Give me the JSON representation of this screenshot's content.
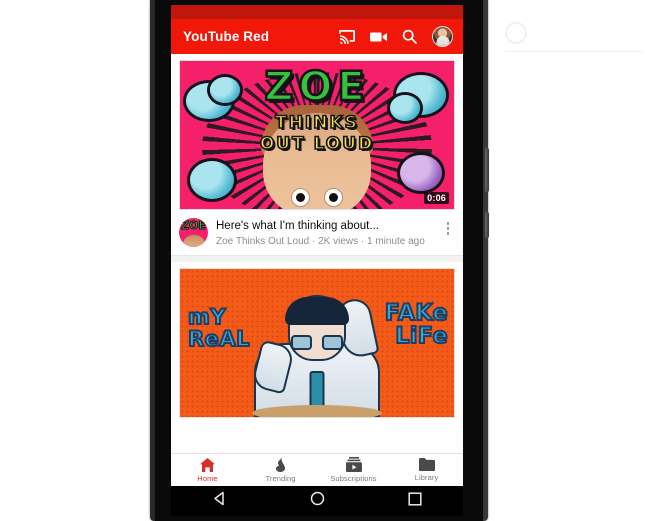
{
  "watermark": {
    "text": ""
  },
  "phone": {
    "status_bar_color": "#c0160b",
    "app_bar_color": "#f11709"
  },
  "appbar": {
    "title": "YouTube Red",
    "actions": [
      {
        "name": "cast-icon",
        "label": "Cast"
      },
      {
        "name": "camcorder-icon",
        "label": "Upload video"
      },
      {
        "name": "search-icon",
        "label": "Search"
      },
      {
        "name": "avatar",
        "label": "Account"
      }
    ]
  },
  "feed": {
    "videos": [
      {
        "title": "Here's what I'm thinking about...",
        "channel": "Zoe Thinks Out Loud",
        "views": "2K views",
        "age": "1 minute ago",
        "meta": "Zoe Thinks Out Loud · 2K views · 1 minute ago",
        "duration": "0:06",
        "thumbnail": {
          "name": "zoe-thinks-out-loud-thumbnail",
          "title_line": "ZOE",
          "sub_line_1": "THINKS",
          "sub_line_2": "OUT LOUD",
          "bg_color": "#f5206a",
          "title_color": "#35c13a",
          "sub_color": "#f2e24a"
        }
      },
      {
        "thumbnail": {
          "name": "my-real-fake-life-thumbnail",
          "left_line_1": "mY",
          "left_line_2": "ReAL",
          "right_line_1": "FAKe",
          "right_line_2": "LiFe",
          "bg_color": "#f25c18",
          "text_color": "#39a8d8"
        }
      }
    ]
  },
  "bottom_nav": {
    "active": "Home",
    "items": [
      {
        "label": "Home",
        "icon": "home-icon",
        "active": true
      },
      {
        "label": "Trending",
        "icon": "flame-icon",
        "active": false
      },
      {
        "label": "Subscriptions",
        "icon": "subscriptions-icon",
        "active": false
      },
      {
        "label": "Library",
        "icon": "folder-icon",
        "active": false
      }
    ]
  },
  "system_nav": {
    "items": [
      {
        "name": "android-back-button",
        "glyph": "back-triangle"
      },
      {
        "name": "android-home-button",
        "glyph": "home-circle"
      },
      {
        "name": "android-recents-button",
        "glyph": "recents-square"
      }
    ]
  }
}
